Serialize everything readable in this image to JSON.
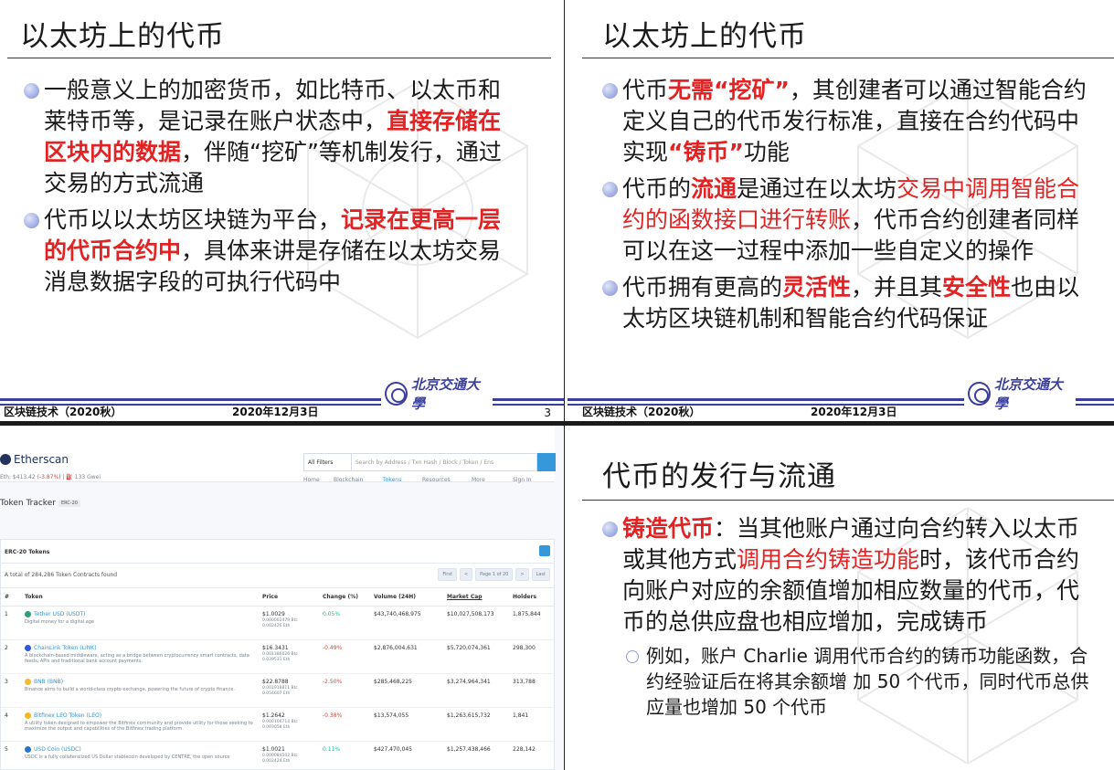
{
  "slide1": {
    "title": "以太坊上的代币",
    "b1_t1": "一般意义上的加密货币，如比特币、以太币和莱特币等，是记录在账户状态中，",
    "b1_red": "直接存储在区块内的数据",
    "b1_t2": "，伴随“挖矿”等机制发行，通过交易的方式流通",
    "b2_t1": "代币以以太坊区块链为平台，",
    "b2_red": "记录在更高一层的代币合约中",
    "b2_t2": "，具体来讲是存储在以太坊交易消息数据字段的可执行代码中",
    "footer": {
      "course": "区块链技术（2020秋）",
      "date": "2020年12月3日",
      "page": "3",
      "logo_text": "北京交通大學"
    }
  },
  "slide2": {
    "title": "以太坊上的代币",
    "b1_t1": "代币",
    "b1_red": "无需“挖矿”",
    "b1_t2": "，其创建者可以通过智能合约定义自己的代币发行标准，直接在合约代码中实现",
    "b1_red2": "“铸币”",
    "b1_t3": "功能",
    "b2_t1": "代币的",
    "b2_red": "流通",
    "b2_t2": "是通过在以太坊",
    "b2_red2": "交易中调用智能合约的函数接口进行转账",
    "b2_t3": "，代币合约创建者同样可以在这一过程中添加一些自定义的操作",
    "b3_t1": "代币拥有更高的",
    "b3_red": "灵活性",
    "b3_t2": "，并且其",
    "b3_red2": "安全性",
    "b3_t3": "也由以太坊区块链机制和智能合约代码保证",
    "footer": {
      "course": "区块链技术（2020秋）",
      "date": "2020年12月3日",
      "logo_text": "北京交通大學"
    }
  },
  "etherscan": {
    "brand": "Etherscan",
    "price_prefix": "Eth: $413.42",
    "price_change": "(-3.87%)",
    "gas": "| ⛽ 133 Gwei",
    "filter": "All Filters",
    "search_placeholder": "Search by Address / Txn Hash / Block / Token / Ens",
    "nav": [
      "Home",
      "Blockchain",
      "Tokens",
      "Resources",
      "More",
      "Sign In"
    ],
    "page_title": "Token Tracker",
    "badge": "ERC-20",
    "card_title": "ERC-20 Tokens",
    "total": "A total of 284,286 Token Contracts found",
    "pager": [
      "First",
      "<",
      "Page 1 of 20",
      ">",
      "Last"
    ],
    "columns": [
      "#",
      "Token",
      "Price",
      "Change (%)",
      "Volume (24H)",
      "Market Cap",
      "Holders"
    ],
    "rows": [
      {
        "n": "1",
        "name": "Tether USD (USDT)",
        "desc": "Digital money for a digital age",
        "price": "$1.0029",
        "p2": "0.000002479 Btc",
        "p3": "0.002426 Eth",
        "change": "0.05%",
        "dir": "pos",
        "vol": "$43,740,468,975",
        "mcap": "$10,027,508,173",
        "holders": "1,875,844",
        "color": "#26a17b"
      },
      {
        "n": "2",
        "name": "ChainLink Token (LINK)",
        "desc": "A blockchain-based middleware, acting as a bridge between cryptocurrency smart contracts, data feeds, APIs and traditional bank account payments.",
        "price": "$16.3431",
        "p2": "0.001386026 Btc",
        "p3": "0.039531 Eth",
        "change": "-0.49%",
        "dir": "neg",
        "vol": "$2,876,004,631",
        "mcap": "$5,720,074,361",
        "holders": "298,300",
        "color": "#2a5ada"
      },
      {
        "n": "3",
        "name": "BNB (BNB)",
        "desc": "Binance aims to build a world-class crypto exchange, powering the future of crypto finance.",
        "price": "$22.8788",
        "p2": "0.001918811 Btc",
        "p3": "0.054607 Eth",
        "change": "-2.50%",
        "dir": "neg",
        "vol": "$285,468,225",
        "mcap": "$3,274,964,341",
        "holders": "313,788",
        "color": "#f3ba2f"
      },
      {
        "n": "4",
        "name": "Bitfinex LEO Token (LEO)",
        "desc": "A utility token designed to empower the Bitfinex community and provide utility for those seeking to maximize the output and capabilities of the Bitfinex trading platform.",
        "price": "$1.2642",
        "p2": "0.000106714 Btc",
        "p3": "0.003058 Eth",
        "change": "-0.38%",
        "dir": "neg",
        "vol": "$13,574,055",
        "mcap": "$1,263,615,732",
        "holders": "1,841",
        "color": "#f4b81c"
      },
      {
        "n": "5",
        "name": "USD Coin (USDC)",
        "desc": "USDC is a fully collateralized US Dollar stablecoin developed by CENTRE, the open source",
        "price": "$1.0021",
        "p2": "0.000084502 Btc",
        "p3": "0.002424 Eth",
        "change": "0.11%",
        "dir": "pos",
        "vol": "$427,470,045",
        "mcap": "$1,257,438,466",
        "holders": "228,142",
        "color": "#2775ca"
      }
    ]
  },
  "slide4": {
    "title": "代币的发行与流通",
    "b1_red": "铸造代币",
    "b1_t1": "：当其他账户通过向合约转入以太币或其他方式",
    "b1_red2": "调用合约铸造功能",
    "b1_t2": "时，该代币合约向账户对应的余额值增加相应数量的代币，代币的总供应盘也相应增加，完成铸币",
    "sub1": "例如，账户 Charlie 调用代币合约的铸币功能函数，合约经验证后在将其余额增 加 50 个代币，同时代币总供应量也增加 50 个代币"
  }
}
